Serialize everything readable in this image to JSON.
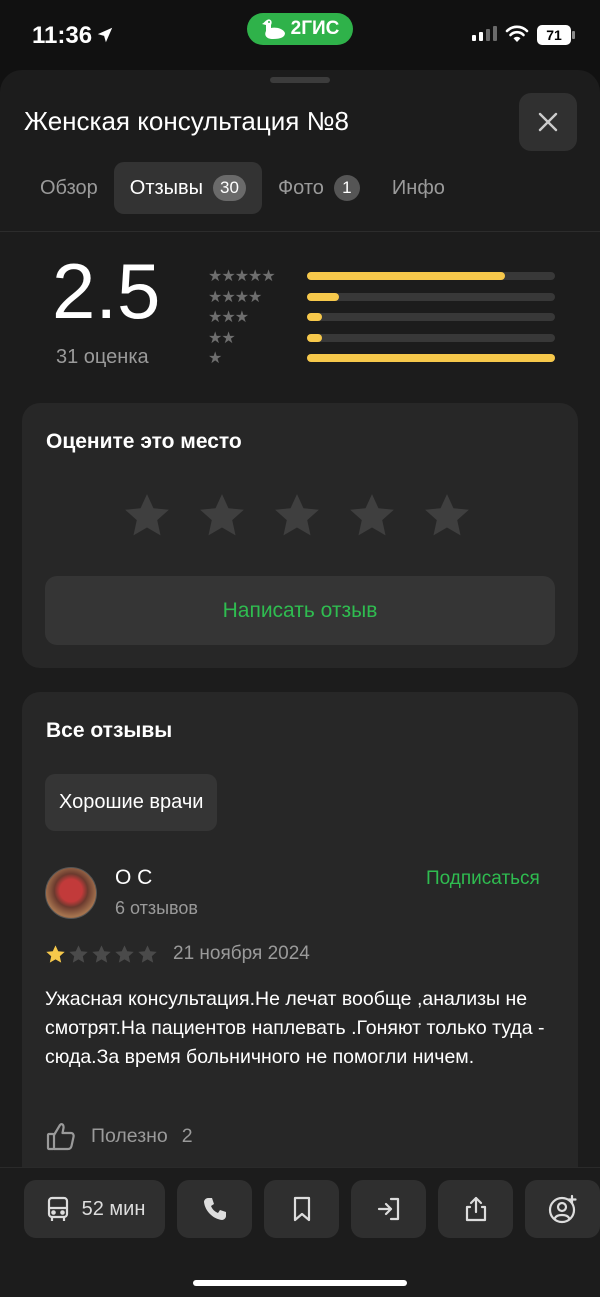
{
  "status_bar": {
    "time": "11:36",
    "app_pill": "2ГИС",
    "battery": "71"
  },
  "header": {
    "title": "Женская консультация №8"
  },
  "tabs": [
    {
      "label": "Обзор",
      "badge": null,
      "active": false
    },
    {
      "label": "Отзывы",
      "badge": "30",
      "active": true
    },
    {
      "label": "Фото",
      "badge": "1",
      "active": false
    },
    {
      "label": "Инфо",
      "badge": null,
      "active": false
    }
  ],
  "summary": {
    "rating": "2.5",
    "count_label": "31 оценка",
    "distribution": [
      {
        "stars": 5,
        "fraction": 0.8
      },
      {
        "stars": 4,
        "fraction": 0.13
      },
      {
        "stars": 3,
        "fraction": 0.06
      },
      {
        "stars": 2,
        "fraction": 0.06
      },
      {
        "stars": 1,
        "fraction": 1.0
      }
    ]
  },
  "rate_card": {
    "title": "Оцените это место",
    "write_button": "Написать отзыв"
  },
  "reviews_card": {
    "title": "Все отзывы",
    "chip": "Хорошие врачи",
    "review": {
      "author": "О С",
      "author_sub": "6 отзывов",
      "subscribe": "Подписаться",
      "stars": 1,
      "date": "21 ноября 2024",
      "text": "Ужасная консультация.Не лечат вообще ,анализы не смотрят.На пациентов наплевать .Гоняют только туда - сюда.За время больничного не помогли ничем.",
      "helpful_label": "Полезно",
      "helpful_count": "2"
    }
  },
  "bottom_bar": {
    "transit_label": "52 мин"
  },
  "colors": {
    "accent_green": "#2fbc50",
    "star_yellow": "#f6c84b",
    "background": "#1c1c1c",
    "card": "#272727"
  }
}
